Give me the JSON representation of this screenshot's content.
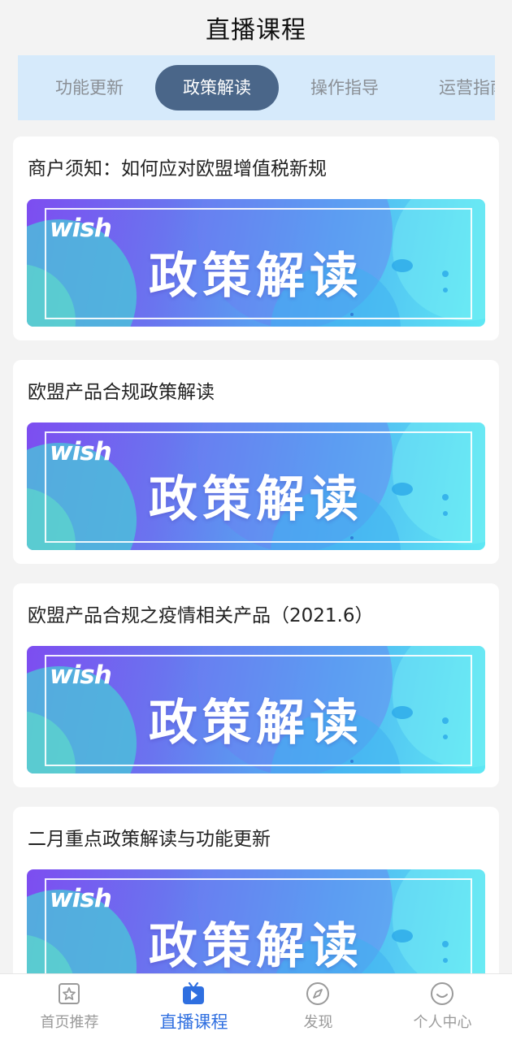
{
  "header": {
    "title": "直播课程"
  },
  "tabs": [
    {
      "label": "功能更新",
      "active": false
    },
    {
      "label": "政策解读",
      "active": true
    },
    {
      "label": "操作指导",
      "active": false
    },
    {
      "label": "运营指南",
      "active": false
    }
  ],
  "cards": [
    {
      "title": "商户须知：如何应对欧盟增值税新规",
      "banner_logo": "wish",
      "banner_text": "政策解读"
    },
    {
      "title": "欧盟产品合规政策解读",
      "banner_logo": "wish",
      "banner_text": "政策解读"
    },
    {
      "title": "欧盟产品合规之疫情相关产品（2021.6）",
      "banner_logo": "wish",
      "banner_text": "政策解读"
    },
    {
      "title": "二月重点政策解读与功能更新",
      "banner_logo": "wish",
      "banner_text": "政策解读"
    }
  ],
  "bottom_nav": [
    {
      "label": "首页推荐",
      "icon": "star-icon",
      "active": false
    },
    {
      "label": "直播课程",
      "icon": "tv-play-icon",
      "active": true
    },
    {
      "label": "发现",
      "icon": "compass-icon",
      "active": false
    },
    {
      "label": "个人中心",
      "icon": "smile-icon",
      "active": false
    }
  ],
  "colors": {
    "accent": "#2f6fe0",
    "tab_active_bg": "#4a6689",
    "tabs_bg": "#d6eafb"
  }
}
